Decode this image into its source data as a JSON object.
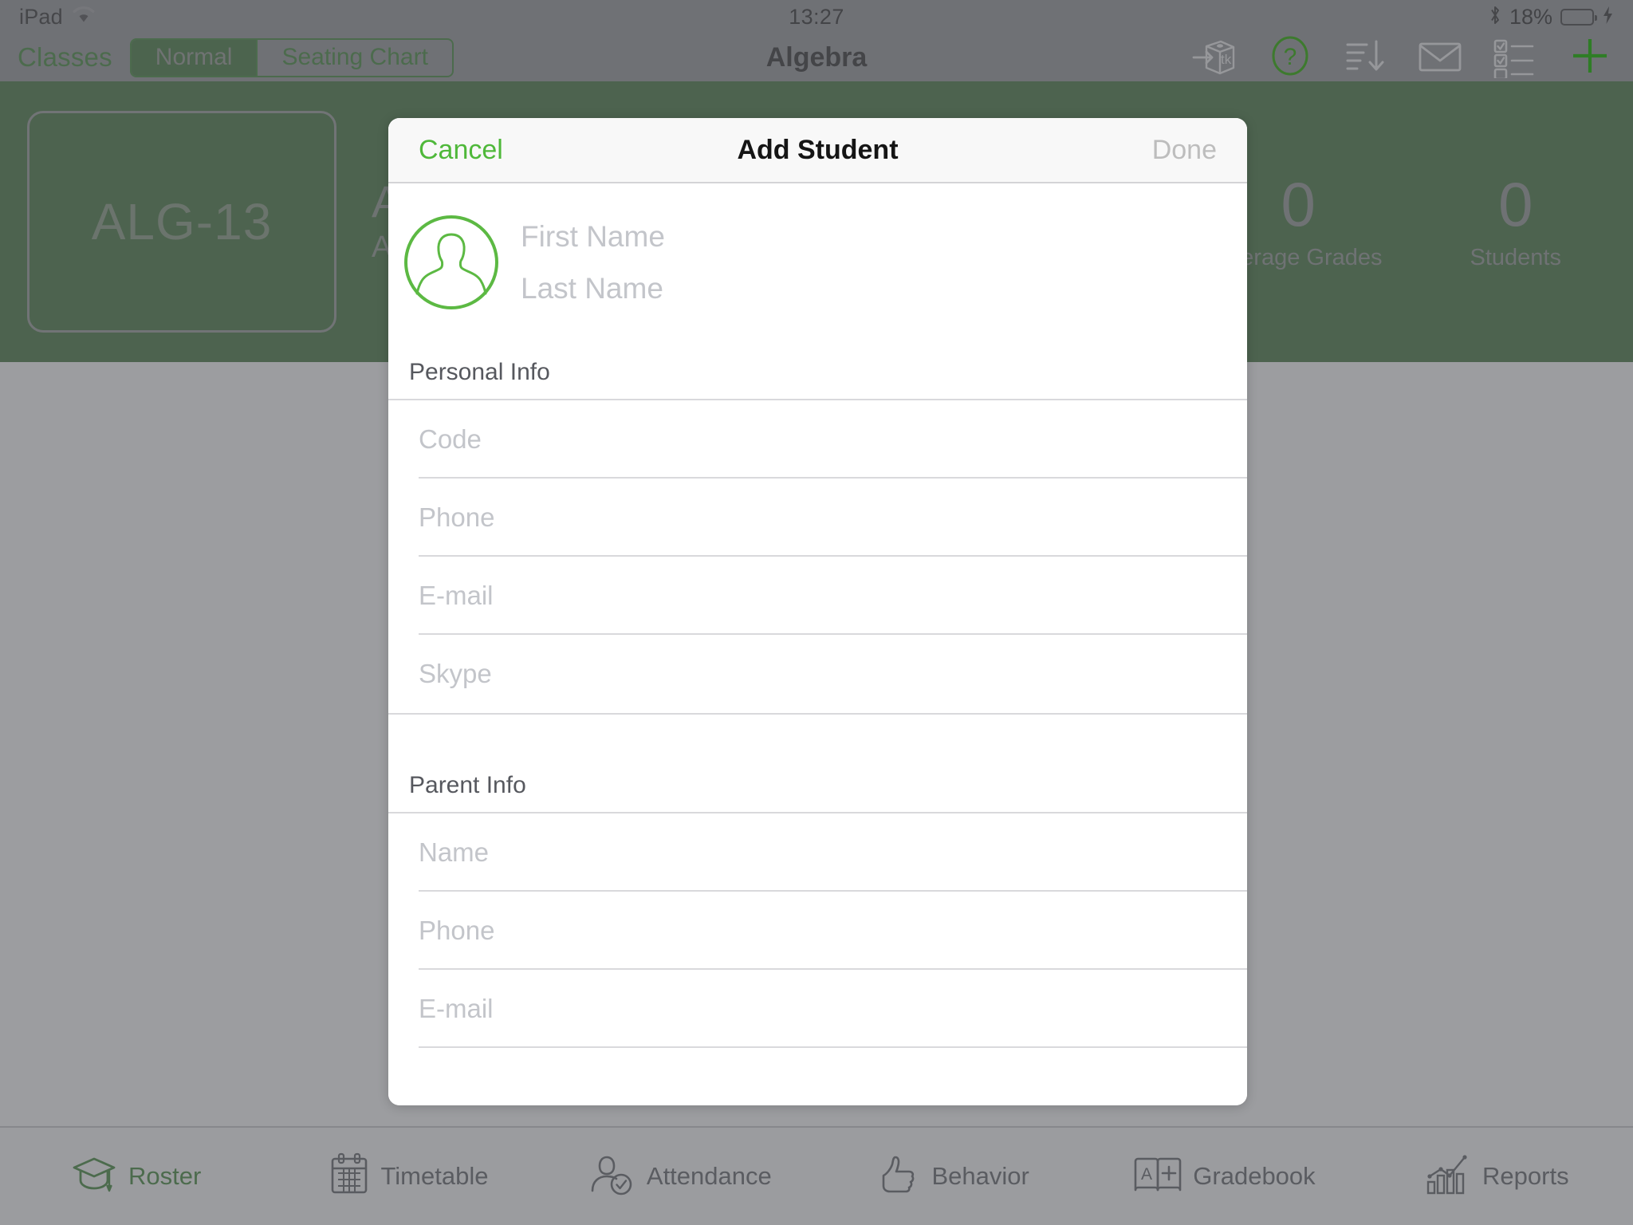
{
  "status_bar": {
    "device": "iPad",
    "wifi_icon": "wifi-icon",
    "time": "13:27",
    "bluetooth_icon": "bluetooth-icon",
    "battery_percent": "18%",
    "battery_level": 18,
    "charging_icon": "lightning-bolt-icon"
  },
  "nav": {
    "back_label": "Classes",
    "title": "Algebra",
    "segments": [
      {
        "label": "Normal",
        "selected": true
      },
      {
        "label": "Seating Chart",
        "selected": false
      }
    ],
    "actions": [
      {
        "name": "import-box-button",
        "icon": "import-box-icon",
        "enabled": false
      },
      {
        "name": "help-button",
        "icon": "question-mark-circle-icon",
        "enabled": true
      },
      {
        "name": "sort-button",
        "icon": "sort-descending-icon",
        "enabled": false
      },
      {
        "name": "mail-button",
        "icon": "envelope-icon",
        "enabled": false
      },
      {
        "name": "checklist-button",
        "icon": "checklist-icon",
        "enabled": false
      },
      {
        "name": "add-button",
        "icon": "plus-icon",
        "enabled": true
      }
    ]
  },
  "class_header": {
    "thumb_label": "ALG-13",
    "name": "Algebra",
    "subtitle": "Algebra",
    "stats": [
      {
        "value": "0",
        "label": "Average Grades"
      },
      {
        "value": "0",
        "label": "Students"
      }
    ]
  },
  "modal": {
    "cancel_label": "Cancel",
    "title": "Add Student",
    "done_label": "Done",
    "avatar_icon": "person-placeholder-icon",
    "name_fields": [
      {
        "name": "first-name-input",
        "placeholder": "First Name",
        "value": ""
      },
      {
        "name": "last-name-input",
        "placeholder": "Last Name",
        "value": ""
      }
    ],
    "sections": [
      {
        "title": "Personal Info",
        "fields": [
          {
            "name": "code-input",
            "placeholder": "Code",
            "value": "",
            "underline": true
          },
          {
            "name": "phone-input",
            "placeholder": "Phone",
            "value": "",
            "underline": true
          },
          {
            "name": "email-input",
            "placeholder": "E-mail",
            "value": "",
            "underline": true
          },
          {
            "name": "skype-input",
            "placeholder": "Skype",
            "value": "",
            "underline": false
          }
        ]
      },
      {
        "title": "Parent Info",
        "fields": [
          {
            "name": "parent-name-input",
            "placeholder": "Name",
            "value": "",
            "underline": true
          },
          {
            "name": "parent-phone-input",
            "placeholder": "Phone",
            "value": "",
            "underline": true
          },
          {
            "name": "parent-email-input",
            "placeholder": "E-mail",
            "value": "",
            "underline": true
          }
        ]
      }
    ]
  },
  "tabbar": {
    "items": [
      {
        "label": "Roster",
        "icon": "graduation-cap-icon",
        "active": true
      },
      {
        "label": "Timetable",
        "icon": "calendar-icon",
        "active": false
      },
      {
        "label": "Attendance",
        "icon": "person-check-icon",
        "active": false
      },
      {
        "label": "Behavior",
        "icon": "thumbs-up-icon",
        "active": false
      },
      {
        "label": "Gradebook",
        "icon": "book-a-plus-icon",
        "active": false
      },
      {
        "label": "Reports",
        "icon": "bar-chart-icon",
        "active": false
      }
    ]
  },
  "colors": {
    "brand_green": "#2f7d26",
    "header_green": "#31682a",
    "accent_green": "#4fb83a",
    "dim_overlay": "#606166",
    "placeholder_gray": "#c3c5ca"
  }
}
